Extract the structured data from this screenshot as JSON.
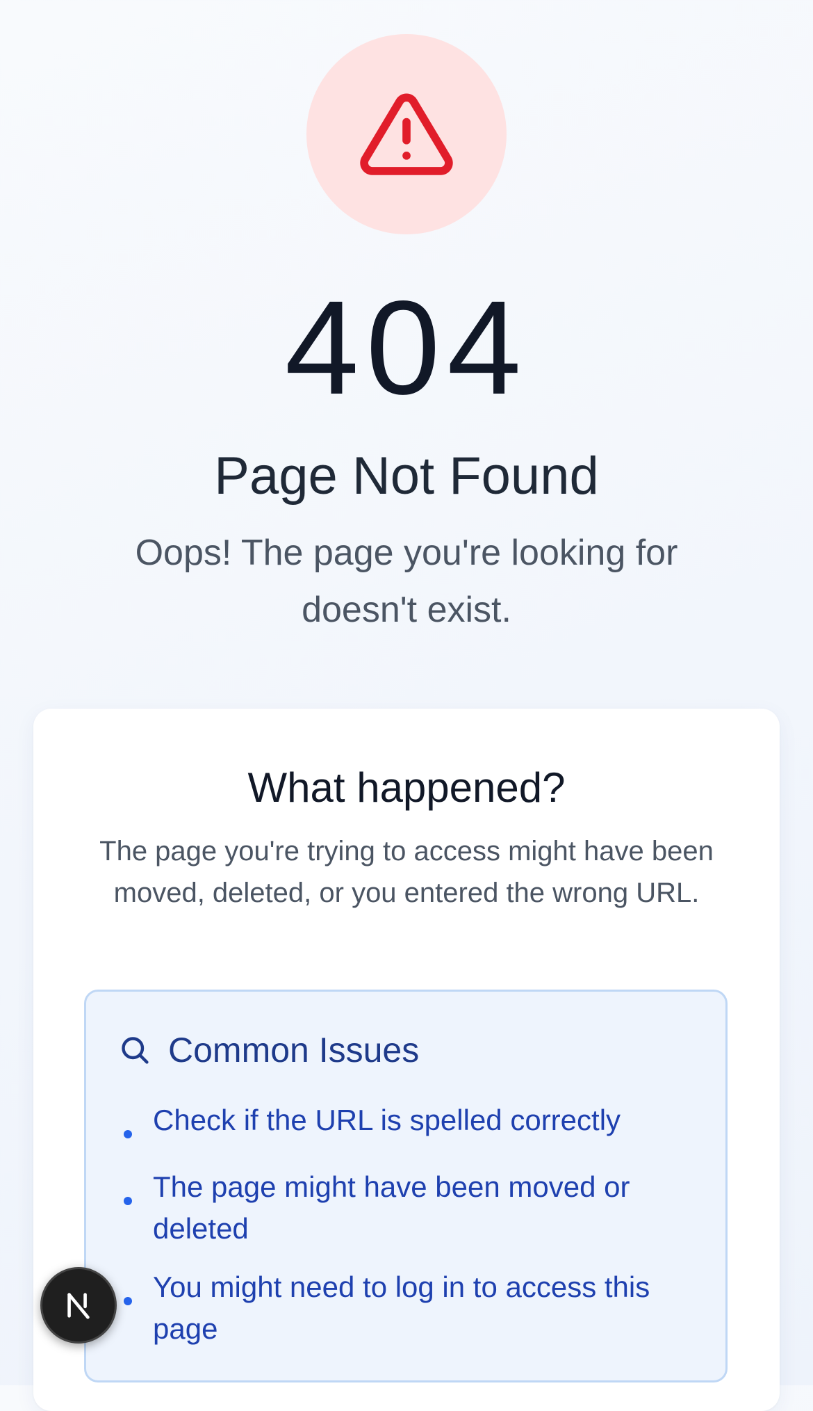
{
  "error": {
    "icon": "alert-triangle-icon",
    "code": "404",
    "title": "Page Not Found",
    "subtitle": "Oops! The page you're looking for doesn't exist."
  },
  "card": {
    "title": "What happened?",
    "body": "The page you're trying to access might have been moved, deleted, or you entered the wrong URL.",
    "issues": {
      "icon": "search-icon",
      "title": "Common Issues",
      "items": [
        "Check if the URL is spelled correctly",
        "The page might have been moved or deleted",
        "You might need to log in to access this page"
      ]
    }
  },
  "dev_badge": {
    "icon": "nextjs-logo-icon"
  },
  "colors": {
    "alert": "#e11d2a",
    "alert_bg": "#fee2e2",
    "accent": "#2563eb",
    "issues_text": "#1e40af",
    "issues_bg": "#eef4fd"
  }
}
